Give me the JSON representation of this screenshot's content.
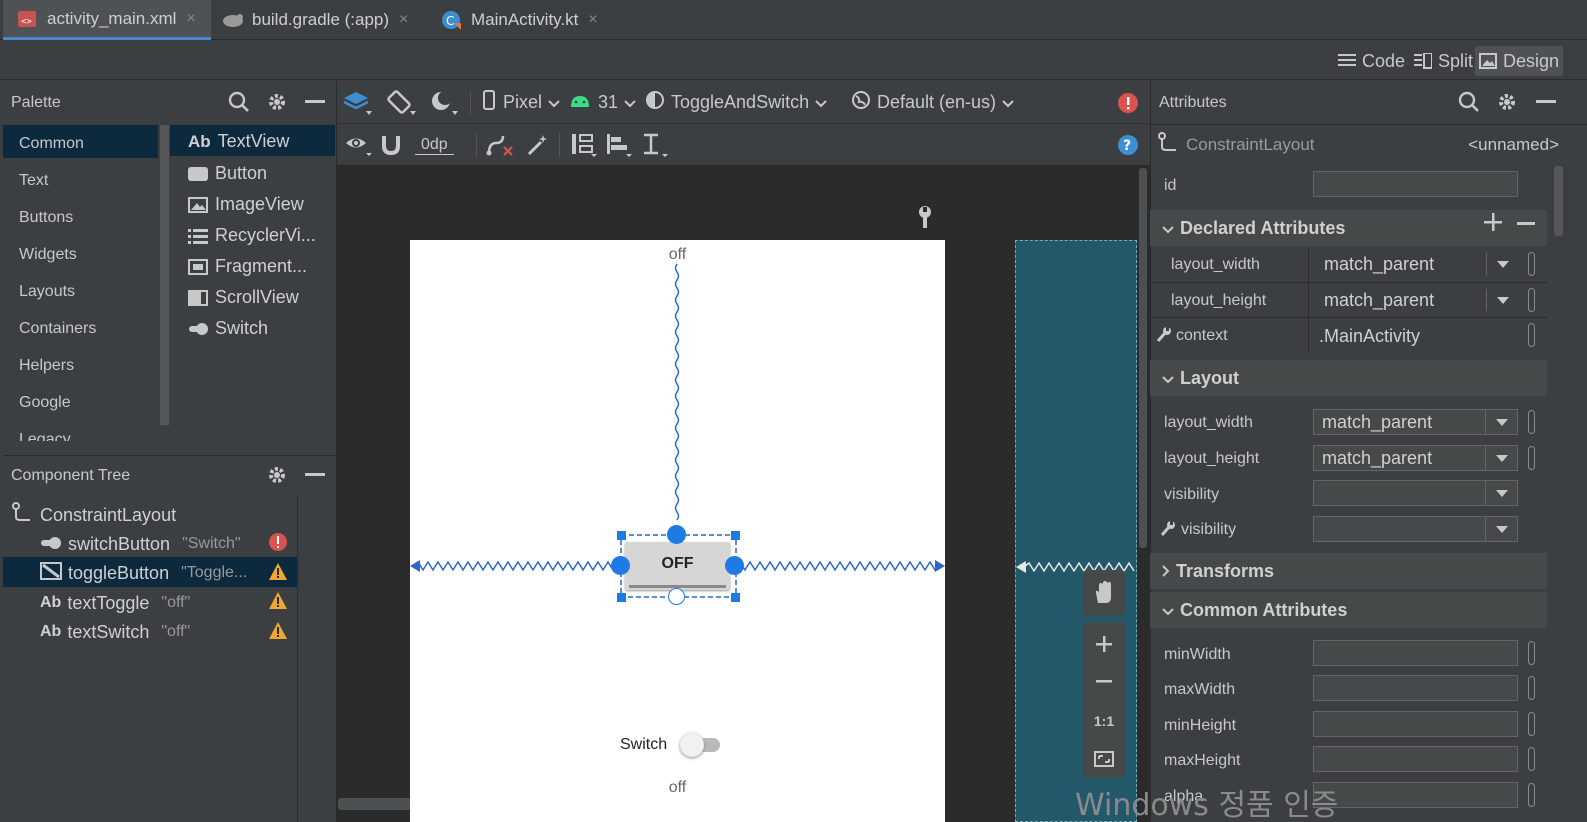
{
  "tabs": [
    {
      "label": "activity_main.xml",
      "close": "×"
    },
    {
      "label": "build.gradle (:app)",
      "close": "×"
    },
    {
      "label": "MainActivity.kt",
      "close": "×"
    }
  ],
  "modes": {
    "code": "Code",
    "split": "Split",
    "design": "Design"
  },
  "palette": {
    "title": "Palette",
    "categories": [
      "Common",
      "Text",
      "Buttons",
      "Widgets",
      "Layouts",
      "Containers",
      "Helpers",
      "Google",
      "Legacy"
    ],
    "items": [
      {
        "prefix": "Ab",
        "label": "TextView"
      },
      {
        "prefix": "",
        "label": "Button"
      },
      {
        "prefix": "",
        "label": "ImageView"
      },
      {
        "prefix": "",
        "label": "RecyclerVi..."
      },
      {
        "prefix": "",
        "label": "Fragment..."
      },
      {
        "prefix": "",
        "label": "ScrollView"
      },
      {
        "prefix": "",
        "label": "Switch"
      }
    ]
  },
  "component_tree": {
    "title": "Component Tree",
    "root": "ConstraintLayout",
    "children": [
      {
        "name": "switchButton",
        "text": "\"Switch\"",
        "status": "error"
      },
      {
        "name": "toggleButton",
        "text": "\"Toggle...",
        "status": "warning"
      },
      {
        "prefix": "Ab",
        "name": "textToggle",
        "text": "\"off\"",
        "status": "warning"
      },
      {
        "prefix": "Ab",
        "name": "textSwitch",
        "text": "\"off\"",
        "status": "warning"
      }
    ]
  },
  "toolbar": {
    "device": "Pixel",
    "api": "31",
    "theme": "ToggleAndSwitch",
    "locale": "Default (en-us)",
    "margin": "0dp"
  },
  "canvas": {
    "top_text": "off",
    "toggle_text": "OFF",
    "switch_text": "Switch",
    "bottom_text": "off",
    "zoom_one": "1:1"
  },
  "attributes": {
    "title": "Attributes",
    "component": "ConstraintLayout",
    "component_name": "<unnamed>",
    "id_label": "id",
    "id_value": "",
    "declared": {
      "title": "Declared Attributes",
      "rows": [
        {
          "label": "layout_width",
          "value": "match_parent"
        },
        {
          "label": "layout_height",
          "value": "match_parent"
        },
        {
          "label": "context",
          "value": ".MainActivity"
        }
      ]
    },
    "layout": {
      "title": "Layout",
      "rows": [
        {
          "label": "layout_width",
          "value": "match_parent"
        },
        {
          "label": "layout_height",
          "value": "match_parent"
        },
        {
          "label": "visibility",
          "value": ""
        },
        {
          "label": "visibility",
          "value": ""
        }
      ]
    },
    "transforms": "Transforms",
    "common": {
      "title": "Common Attributes",
      "rows": [
        {
          "label": "minWidth",
          "value": ""
        },
        {
          "label": "maxWidth",
          "value": ""
        },
        {
          "label": "minHeight",
          "value": ""
        },
        {
          "label": "maxHeight",
          "value": ""
        },
        {
          "label": "alpha",
          "value": ""
        }
      ]
    }
  },
  "watermark": "Windows 정품 인증",
  "colors": {
    "accent": "#4a88c7",
    "selection": "#2f65ca",
    "blueprint": "#22586a",
    "error": "#d9534f",
    "warning": "#f0a732"
  }
}
